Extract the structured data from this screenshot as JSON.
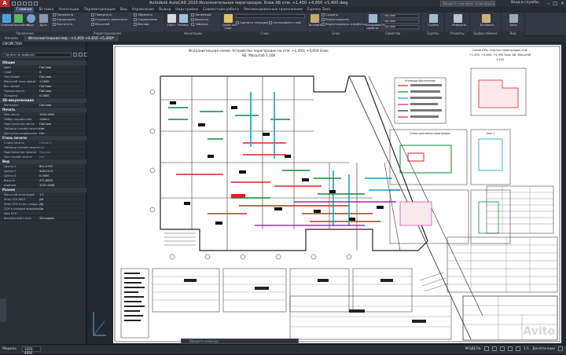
{
  "app": {
    "logo": "A",
    "title": "Autodesk AutoCAD 2020  Исполнительная перегородок. Блок АБ отм. +1,450 +4,650 +5,400.dwg",
    "search_placeholder": "Введите ключевое слово/фразу",
    "sign_in": "Вход в службы"
  },
  "ribbon_tabs": [
    "Главная",
    "Вставка",
    "Аннотации",
    "Параметризация",
    "Вид",
    "Управление",
    "Вывод",
    "Надстройки",
    "Совместная работа",
    "Рекомендованные приложения",
    "Express Tools"
  ],
  "ribbon_active_tab": "Главная",
  "ribbon": {
    "draw": {
      "label": "Рисование",
      "buttons": [
        "Отрезок",
        "Полилиния",
        "Круг",
        "Дуга"
      ]
    },
    "modify": {
      "label": "Редактирование",
      "rows": [
        "Перенести",
        "Копировать",
        "Растянуть",
        "Повернуть",
        "Отразить зеркально",
        "Масштаб",
        "Обрезать",
        "Сопряжение",
        "Массив"
      ]
    },
    "annotation": {
      "label": "Аннотации",
      "buttons": [
        "Текст",
        "Размер"
      ],
      "rows": [
        "Линейный",
        "Выноска",
        "Таблица"
      ]
    },
    "layers": {
      "label": "Слои",
      "buttons": [
        "Свойства слоя"
      ],
      "rows": [
        "Сделать текущим",
        "Согласовать слой"
      ]
    },
    "block": {
      "label": "Блок",
      "buttons": [
        "Вставить"
      ],
      "rows": [
        "Создать",
        "Редактировать",
        "Редактировать атрибуты"
      ]
    },
    "properties": {
      "label": "Свойства",
      "buttons": [
        "Копирование свойств"
      ],
      "combo": "ПоСлою"
    },
    "groups": {
      "label": "Группы",
      "buttons": [
        "Группа"
      ]
    },
    "utilities": {
      "label": "Утилиты",
      "buttons": [
        "Измерить"
      ]
    },
    "clipboard": {
      "label": "Буфер обмена",
      "buttons": [
        "Вставить"
      ]
    },
    "view": {
      "label": "Вид",
      "buttons": [
        "База"
      ]
    }
  },
  "file_tabs": [
    "Начало",
    "Исполнительная пер...+1,450 +4,650 +5,400*"
  ],
  "file_tab_active": 1,
  "properties_panel": {
    "header": "СВОЙСТВА",
    "selection": "Ничего не выбрано",
    "sections": [
      {
        "name": "Общие",
        "rows": [
          [
            "Цвет",
            "ПоСлою"
          ],
          [
            "Слой",
            "0"
          ],
          [
            "Тип линий",
            "ПоСлою"
          ],
          [
            "Масштаб типа линий",
            "1.0000"
          ],
          [
            "Вес линий",
            "ПоСлою"
          ],
          [
            "Прозрачность",
            "ПоСлою"
          ],
          [
            "Толщина",
            "0.0000"
          ]
        ]
      },
      {
        "name": "3D-визуализация",
        "rows": [
          [
            "Материал",
            "ПоСлою"
          ]
        ]
      },
      {
        "name": "Печать",
        "rows": [
          [
            "Имя листа",
            "1450-4950"
          ],
          [
            "Набор параметров",
            "<Нет>"
          ],
          [
            "Пространство листа",
            "ПоСлою"
          ],
          [
            "Таблица стилей печати",
            "Нет"
          ],
          [
            "Доступно разрешение",
            "Нет"
          ]
        ]
      },
      {
        "name": "Стиль печати",
        "rows": [
          [
            "Стиль печати",
            "ПоЦвету"
          ],
          [
            "Таблица стилей печати",
            "Нет"
          ],
          [
            "Пространство печати",
            "Модель"
          ],
          [
            "Тип стилей печати",
            "Нет"
          ]
        ]
      },
      {
        "name": "Вид",
        "rows": [
          [
            "Центр X",
            "801.0797"
          ],
          [
            "Центр Y",
            "418.2113"
          ],
          [
            "Центр Z",
            "0.0000"
          ],
          [
            "Высота",
            "471.8823"
          ],
          [
            "Ширина",
            "1237.4848"
          ]
        ]
      },
      {
        "name": "Разное",
        "rows": [
          [
            "Масштаб аннотаций",
            "1:1"
          ],
          [
            "Знак ПСК ВКЛ",
            "Да"
          ],
          [
            "Знак ПСК в нач. коорд.",
            "Да"
          ],
          [
            "ПСК в каждом видовом экране",
            "Да"
          ],
          [
            "Имя ПСК",
            ""
          ],
          [
            "Визуальный стиль",
            "2D-каркас"
          ]
        ]
      }
    ]
  },
  "drawing": {
    "main_title": "Исполнительная схема. Устройство перегородок на отм. +1,450; +4,650 Блок АБ. Масштаб 1:100",
    "right_title": "Схема КРЦ. Участок перегородок отм. +1,450; +4,650; +4,950 Блок АБ. Масштаб 1:100",
    "section_title_1": "Схема крепления перегородок",
    "section_title_2": "Узел 1",
    "legend_title": "Условные обозначения",
    "colors": {
      "paper": "#ffffff",
      "lines": "#222222",
      "red": "#e02020",
      "green": "#0a8a3a",
      "cyan": "#15a0c8",
      "magenta": "#c21f9e"
    }
  },
  "command_placeholder": "Введите команду",
  "status": {
    "model": "Модель",
    "coord": "1450-4950",
    "right": [
      "МОДЕЛЬ",
      "1:1",
      "Десятичные"
    ]
  },
  "watermark": "Avito"
}
